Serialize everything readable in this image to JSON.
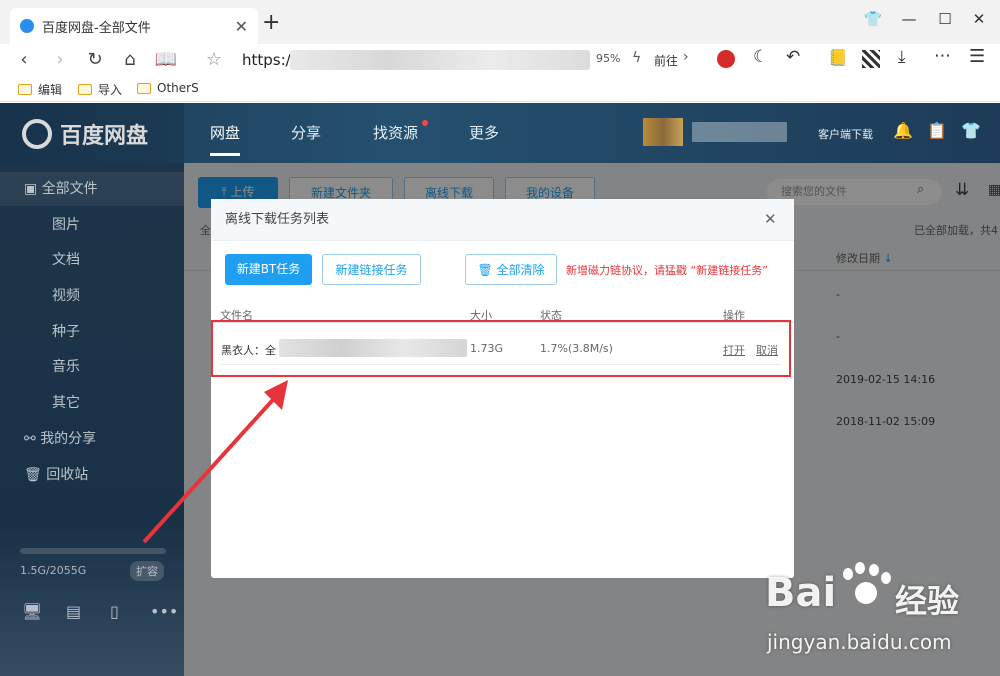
{
  "browser": {
    "tab_title": "百度网盘-全部文件",
    "tab_close": "✕",
    "new_tab": "+",
    "url_prefix": "https://",
    "zoom": "95%",
    "go_label": "前往",
    "bookmarks": [
      "编辑",
      "导入",
      "OtherS"
    ]
  },
  "app": {
    "logo_text": "百度网盘",
    "nav": [
      "网盘",
      "分享",
      "找资源",
      "更多"
    ],
    "client_download": "客户端下载",
    "sidebar": [
      "全部文件",
      "图片",
      "文档",
      "视频",
      "种子",
      "音乐",
      "其它",
      "我的分享",
      "回收站"
    ],
    "storage": "1.5G/2055G",
    "expand": "扩容",
    "toolbar": [
      "上传",
      "新建文件夹",
      "离线下载",
      "我的设备"
    ],
    "search_placeholder": "搜索您的文件",
    "loaded_text": "已全部加载，共4",
    "col_modified": "修改日期",
    "dates": [
      "-",
      "-",
      "2019-02-15 14:16",
      "2018-11-02 15:09"
    ],
    "all_prefix": "全"
  },
  "modal": {
    "title": "离线下载任务列表",
    "close": "✕",
    "new_bt": "新建BT任务",
    "new_link": "新建链接任务",
    "clear_all": "全部清除",
    "notice": "新增磁力链协议，请猛戳 “新建链接任务”",
    "columns": [
      "文件名",
      "大小",
      "状态",
      "操作"
    ],
    "task": {
      "name": "黑衣人：全",
      "size": "1.73G",
      "status": "1.7%(3.8M/s)",
      "open": "打开",
      "cancel": "取消"
    }
  },
  "watermark": {
    "brand": "Bai",
    "brand_cn": "经验",
    "url": "jingyan.baidu.com"
  },
  "colors": {
    "primary": "#1e9ff2",
    "danger": "#e8333a",
    "nav_bg": "#1f3f5c"
  }
}
